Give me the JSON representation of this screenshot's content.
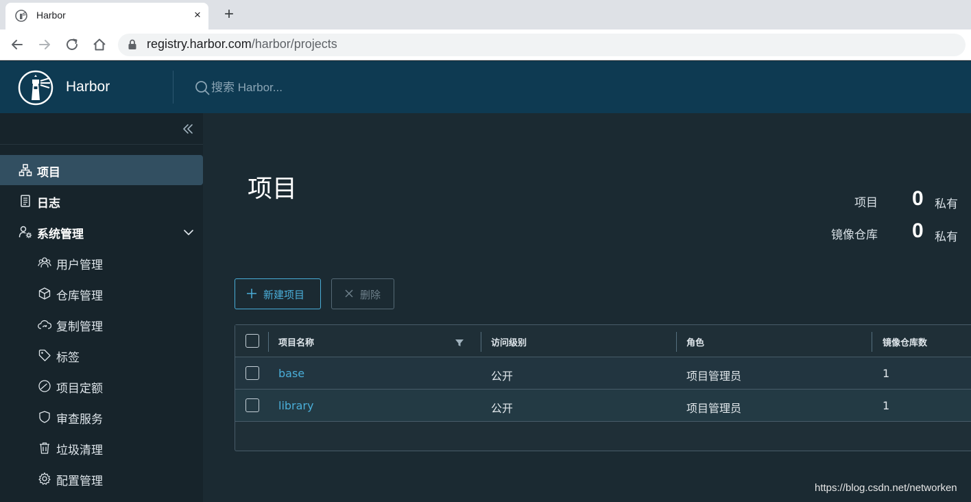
{
  "browser": {
    "tab_title": "Harbor",
    "tab_close": "×",
    "new_tab": "+",
    "url_host": "registry.harbor.com",
    "url_path": "/harbor/projects"
  },
  "app": {
    "brand": "Harbor",
    "search_placeholder": "搜索 Harbor...",
    "colors": {
      "header": "#0e3a52",
      "sidebar": "#17242b",
      "accent": "#4aaed9",
      "active_item": "#324f61"
    }
  },
  "sidebar": {
    "items": [
      {
        "label": "项目",
        "icon": "projects-icon",
        "active": true
      },
      {
        "label": "日志",
        "icon": "logs-icon"
      },
      {
        "label": "系统管理",
        "icon": "admin-icon",
        "expanded": true
      },
      {
        "label": "用户管理",
        "icon": "users-icon"
      },
      {
        "label": "仓库管理",
        "icon": "registry-icon"
      },
      {
        "label": "复制管理",
        "icon": "replication-icon"
      },
      {
        "label": "标签",
        "icon": "tag-icon"
      },
      {
        "label": "项目定额",
        "icon": "quota-icon"
      },
      {
        "label": "审查服务",
        "icon": "shield-icon"
      },
      {
        "label": "垃圾清理",
        "icon": "trash-icon"
      },
      {
        "label": "配置管理",
        "icon": "gear-icon"
      }
    ]
  },
  "main": {
    "title": "项目",
    "stats": [
      {
        "label": "项目",
        "value": "0",
        "unit": "私有"
      },
      {
        "label": "镜像仓库",
        "value": "0",
        "unit": "私有"
      }
    ],
    "new_button": "新建项目",
    "delete_button": "删除"
  },
  "table": {
    "columns": [
      "项目名称",
      "访问级别",
      "角色",
      "镜像仓库数"
    ],
    "rows": [
      {
        "name": "base",
        "access": "公开",
        "role": "项目管理员",
        "repos": "1"
      },
      {
        "name": "library",
        "access": "公开",
        "role": "项目管理员",
        "repos": "1"
      }
    ]
  },
  "watermark": "https://blog.csdn.net/networken"
}
